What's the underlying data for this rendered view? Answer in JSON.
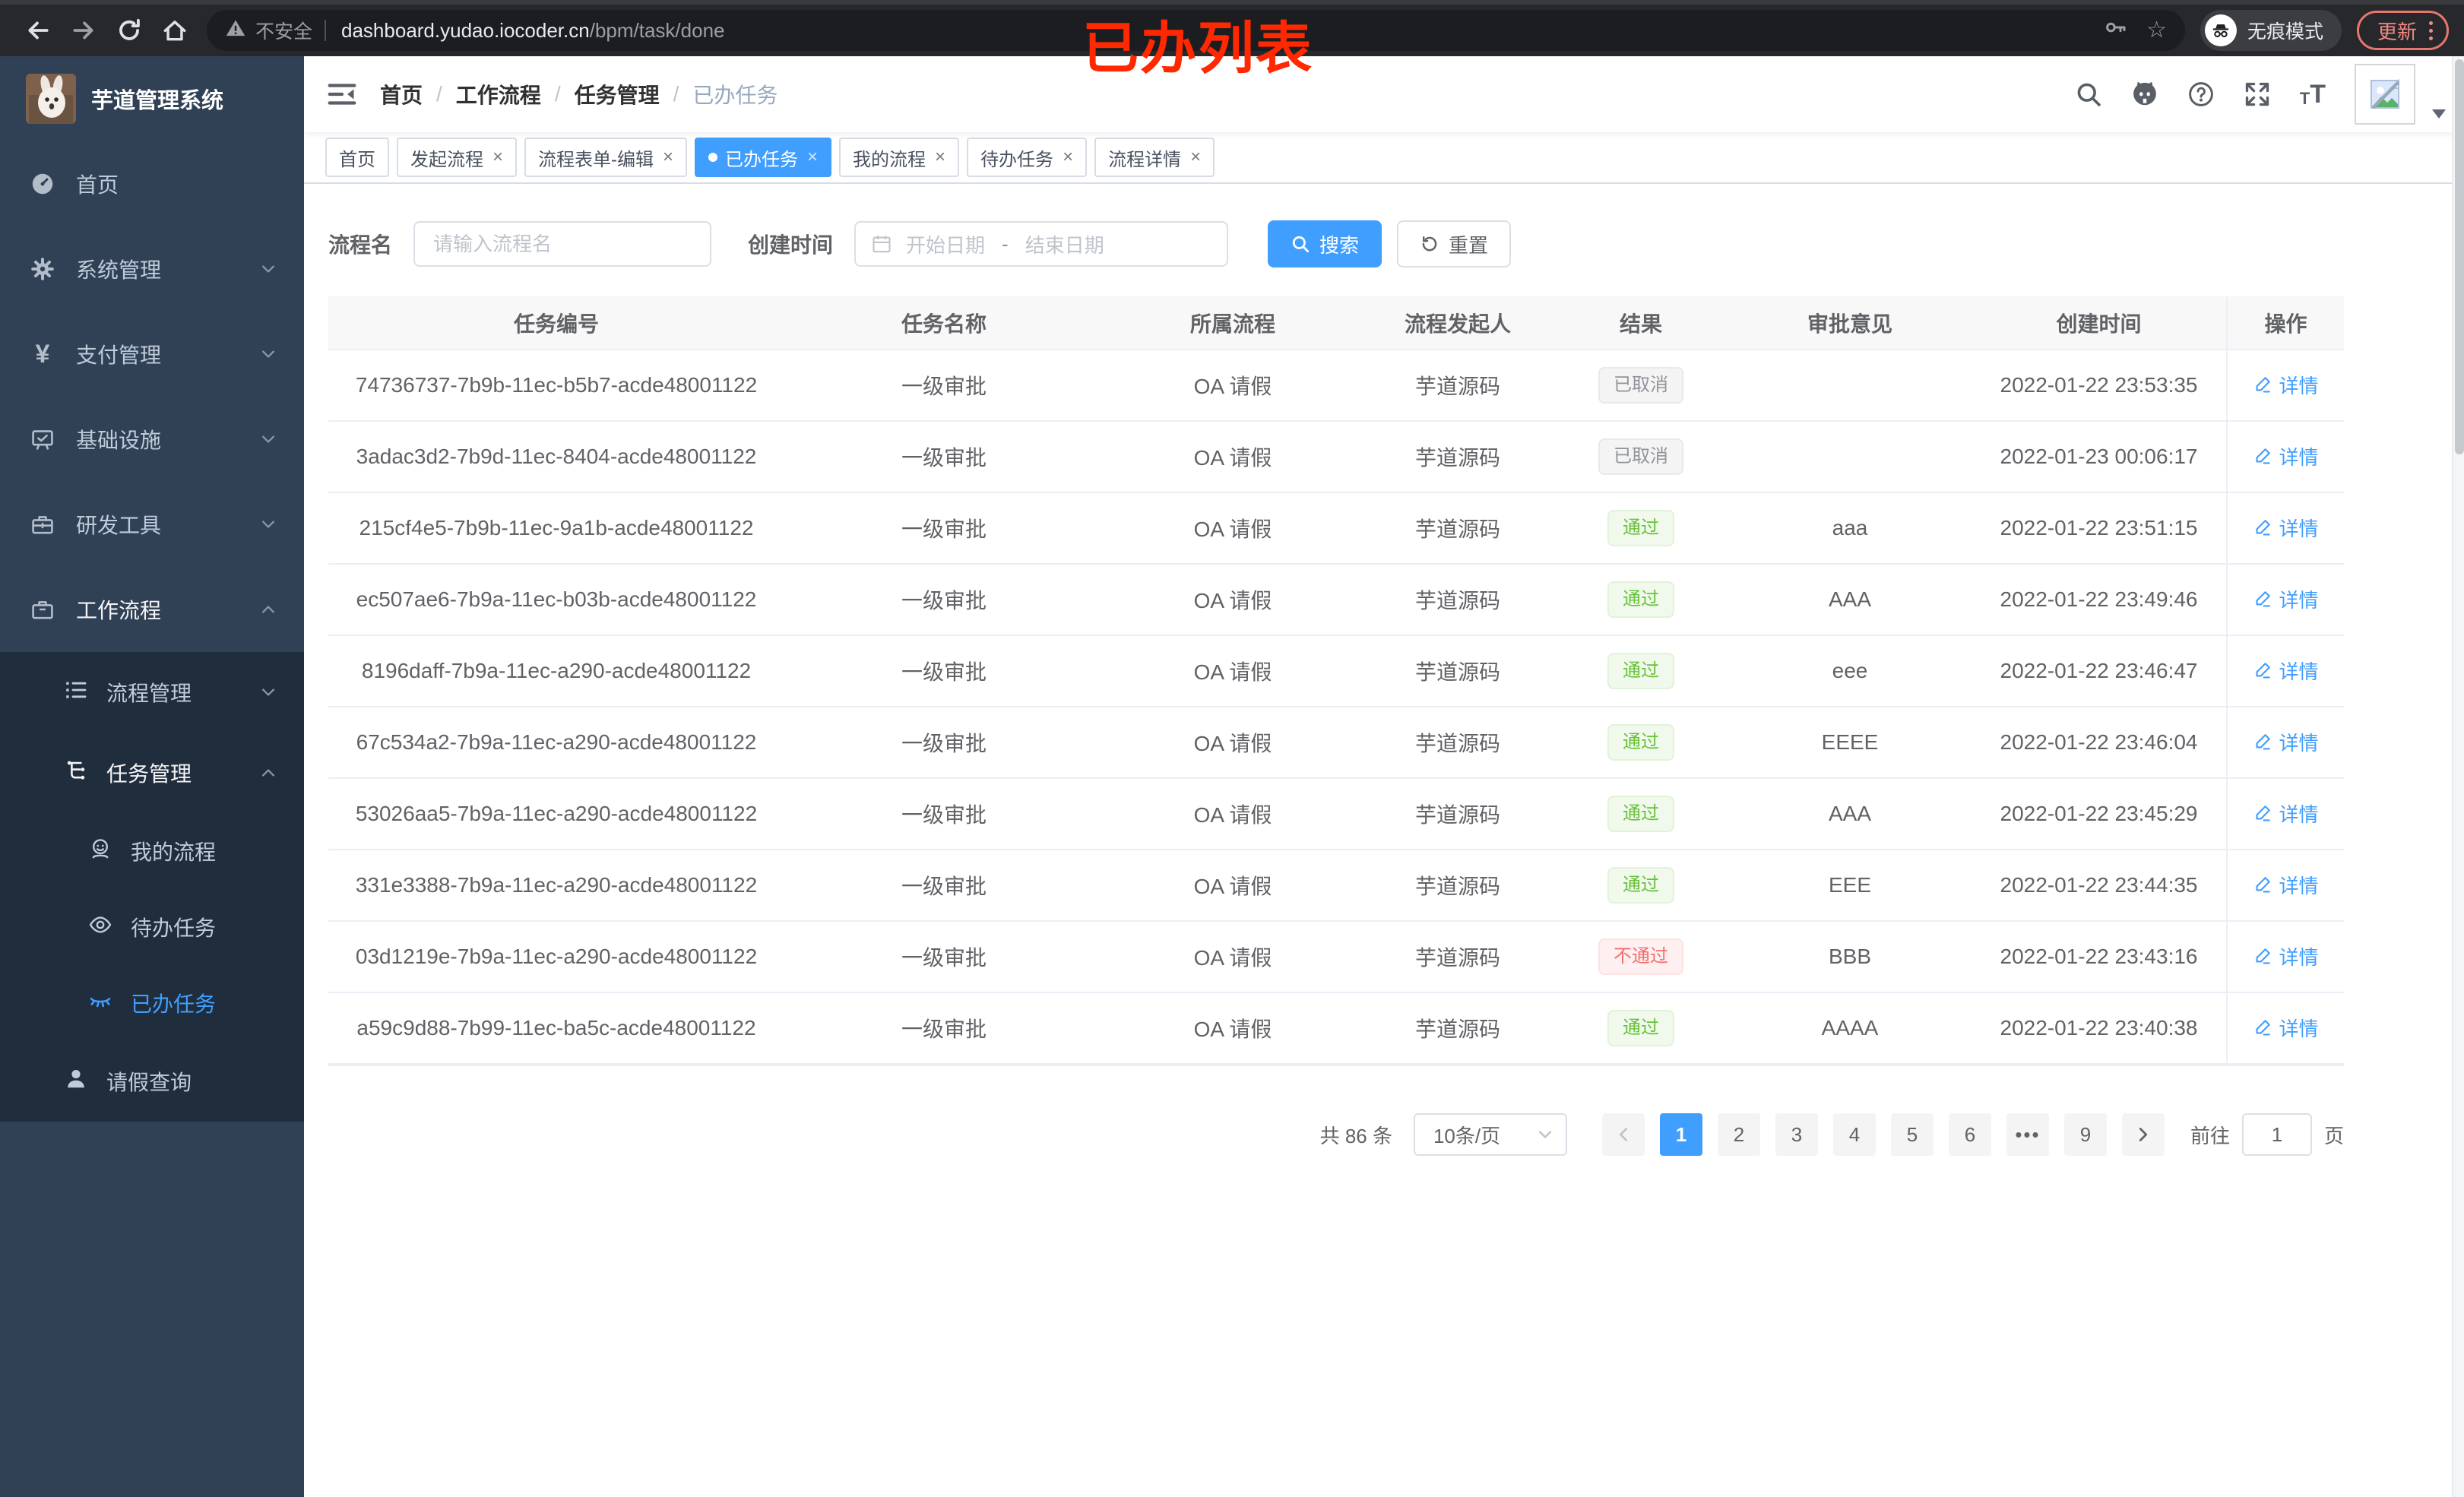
{
  "colors": {
    "accent": "#409eff",
    "success": "#67c23a",
    "danger": "#f56c6c",
    "info": "#909399",
    "sidebar_bg": "#304156",
    "submenu_bg": "#1f2d3d",
    "annotation_red": "#ff2800"
  },
  "browser": {
    "security_text": "不安全",
    "url_host": "dashboard.yudao.iocoder.cn",
    "url_path": "/bpm/task/done",
    "incognito_text": "无痕模式",
    "update_text": "更新",
    "star_glyph": "☆"
  },
  "annotation": {
    "text": "已办列表"
  },
  "sidebar": {
    "title": "芋道管理系统",
    "items": [
      {
        "label": "首页"
      },
      {
        "label": "系统管理"
      },
      {
        "label": "支付管理"
      },
      {
        "label": "基础设施"
      },
      {
        "label": "研发工具"
      },
      {
        "label": "工作流程"
      }
    ],
    "yen_glyph": "¥",
    "submenu": {
      "process_mgmt": "流程管理",
      "task_mgmt": "任务管理",
      "my_process": "我的流程",
      "todo_tasks": "待办任务",
      "done_tasks": "已办任务",
      "leave_query": "请假查询"
    }
  },
  "breadcrumb": {
    "separator": "/",
    "items": [
      {
        "label": "首页"
      },
      {
        "label": "工作流程"
      },
      {
        "label": "任务管理"
      },
      {
        "label": "已办任务",
        "active": true
      }
    ]
  },
  "tabs": {
    "close_glyph": "×",
    "items": [
      {
        "label": "首页",
        "closable": false
      },
      {
        "label": "发起流程",
        "closable": true
      },
      {
        "label": "流程表单-编辑",
        "closable": true
      },
      {
        "label": "已办任务",
        "closable": true,
        "active": true
      },
      {
        "label": "我的流程",
        "closable": true
      },
      {
        "label": "待办任务",
        "closable": true
      },
      {
        "label": "流程详情",
        "closable": true
      }
    ]
  },
  "filters": {
    "name_label": "流程名",
    "name_placeholder": "请输入流程名",
    "name_value": "",
    "time_label": "创建时间",
    "start_placeholder": "开始日期",
    "range_separator": "-",
    "end_placeholder": "结束日期",
    "search_label": "搜索",
    "reset_label": "重置"
  },
  "table": {
    "columns": [
      "任务编号",
      "任务名称",
      "所属流程",
      "流程发起人",
      "结果",
      "审批意见",
      "创建时间",
      "操作"
    ],
    "rows": [
      {
        "id": "74736737-7b9b-11ec-b5b7-acde48001122",
        "name": "一级审批",
        "process": "OA 请假",
        "starter": "芋道源码",
        "result": {
          "text": "已取消",
          "type": "info"
        },
        "comment": "",
        "created": "2022-01-22 23:53:35",
        "action": "详情"
      },
      {
        "id": "3adac3d2-7b9d-11ec-8404-acde48001122",
        "name": "一级审批",
        "process": "OA 请假",
        "starter": "芋道源码",
        "result": {
          "text": "已取消",
          "type": "info"
        },
        "comment": "",
        "created": "2022-01-23 00:06:17",
        "action": "详情"
      },
      {
        "id": "215cf4e5-7b9b-11ec-9a1b-acde48001122",
        "name": "一级审批",
        "process": "OA 请假",
        "starter": "芋道源码",
        "result": {
          "text": "通过",
          "type": "success"
        },
        "comment": "aaa",
        "created": "2022-01-22 23:51:15",
        "action": "详情"
      },
      {
        "id": "ec507ae6-7b9a-11ec-b03b-acde48001122",
        "name": "一级审批",
        "process": "OA 请假",
        "starter": "芋道源码",
        "result": {
          "text": "通过",
          "type": "success"
        },
        "comment": "AAA",
        "created": "2022-01-22 23:49:46",
        "action": "详情"
      },
      {
        "id": "8196daff-7b9a-11ec-a290-acde48001122",
        "name": "一级审批",
        "process": "OA 请假",
        "starter": "芋道源码",
        "result": {
          "text": "通过",
          "type": "success"
        },
        "comment": "eee",
        "created": "2022-01-22 23:46:47",
        "action": "详情"
      },
      {
        "id": "67c534a2-7b9a-11ec-a290-acde48001122",
        "name": "一级审批",
        "process": "OA 请假",
        "starter": "芋道源码",
        "result": {
          "text": "通过",
          "type": "success"
        },
        "comment": "EEEE",
        "created": "2022-01-22 23:46:04",
        "action": "详情"
      },
      {
        "id": "53026aa5-7b9a-11ec-a290-acde48001122",
        "name": "一级审批",
        "process": "OA 请假",
        "starter": "芋道源码",
        "result": {
          "text": "通过",
          "type": "success"
        },
        "comment": "AAA",
        "created": "2022-01-22 23:45:29",
        "action": "详情"
      },
      {
        "id": "331e3388-7b9a-11ec-a290-acde48001122",
        "name": "一级审批",
        "process": "OA 请假",
        "starter": "芋道源码",
        "result": {
          "text": "通过",
          "type": "success"
        },
        "comment": "EEE",
        "created": "2022-01-22 23:44:35",
        "action": "详情"
      },
      {
        "id": "03d1219e-7b9a-11ec-a290-acde48001122",
        "name": "一级审批",
        "process": "OA 请假",
        "starter": "芋道源码",
        "result": {
          "text": "不通过",
          "type": "danger"
        },
        "comment": "BBB",
        "created": "2022-01-22 23:43:16",
        "action": "详情"
      },
      {
        "id": "a59c9d88-7b99-11ec-ba5c-acde48001122",
        "name": "一级审批",
        "process": "OA 请假",
        "starter": "芋道源码",
        "result": {
          "text": "通过",
          "type": "success"
        },
        "comment": "AAAA",
        "created": "2022-01-22 23:40:38",
        "action": "详情"
      }
    ]
  },
  "pagination": {
    "total": "共 86 条",
    "page_size": "10条/页",
    "pages": [
      {
        "label": "1",
        "active": true
      },
      {
        "label": "2"
      },
      {
        "label": "3"
      },
      {
        "label": "4"
      },
      {
        "label": "5"
      },
      {
        "label": "6"
      },
      {
        "label": "•••",
        "type": "ellipsis"
      },
      {
        "label": "9"
      }
    ],
    "goto_label": "前往",
    "goto_value": "1",
    "goto_suffix": "页"
  }
}
